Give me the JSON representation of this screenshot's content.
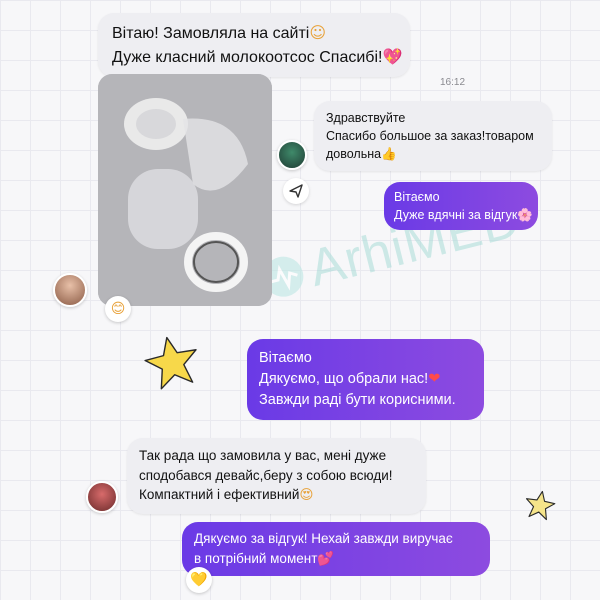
{
  "messages": {
    "m1": {
      "line1": "Вітаю! Замовляла на сайті",
      "emoji1": "☺",
      "line2": "Дуже класний молокоотсос Спасибі!",
      "emoji2": "💖"
    },
    "time": "16:12",
    "m2": {
      "line1": "Здравствуйте",
      "line2": "Спасибо большое за заказ!товаром",
      "line3": "довольна",
      "emoji3": "👍"
    },
    "m3": {
      "line1": "Вітаємо",
      "line2": "Дуже вдячні за відгук",
      "emoji2": "🌸"
    },
    "m4": {
      "line1": "Вітаємо",
      "line2": "Дякуємо, що обрали нас!",
      "emoji2": "❤",
      "line3": "Завжди раді бути корисними."
    },
    "m5": {
      "line1": "Так рада що замовила у вас, мені дуже",
      "line2": "сподобався девайс,беру з собою всюди!",
      "line3": "Компактний і ефективний",
      "emoji3": "😍"
    },
    "m6": {
      "line1": "Дякуємо за відгук! Нехай завжди виручає",
      "line2": "в потрібний момент",
      "emoji2": "💕"
    }
  },
  "reactions": {
    "photo": "😊",
    "last": "💛"
  },
  "watermark": {
    "text": "ArhiMED"
  },
  "icons": {
    "share": "share-icon",
    "star": "star-icon"
  },
  "colors": {
    "purple": "#7b3fe4",
    "gray_bubble": "#eeeef2",
    "watermark": "#9fd8d4"
  }
}
